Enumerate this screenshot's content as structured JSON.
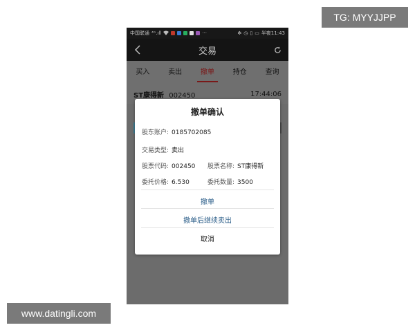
{
  "watermarks": {
    "tg": "TG: MYYJJPP",
    "site": "www.datingli.com"
  },
  "status_bar": {
    "carrier": "中国联通",
    "signal": "⁴ᴳ.ıll",
    "time": "半夜11:43",
    "battery": "▭"
  },
  "nav": {
    "title": "交易"
  },
  "tabs": [
    {
      "label": "买入"
    },
    {
      "label": "卖出"
    },
    {
      "label": "撤单"
    },
    {
      "label": "持仓"
    },
    {
      "label": "查询"
    }
  ],
  "order": {
    "name": "ST康得新",
    "code": "002450",
    "time": "17:44:06"
  },
  "dialog": {
    "title": "撤单确认",
    "account_label": "股东账户:",
    "account": "0185702085",
    "type_label": "交易类型:",
    "type": "卖出",
    "code_label": "股票代码:",
    "code": "002450",
    "name_label": "股票名称:",
    "name": "ST康得新",
    "price_label": "委托价格:",
    "price": "6.530",
    "qty_label": "委托数量:",
    "qty": "3500",
    "actions": {
      "cancel_order": "撤单",
      "cancel_and_sell": "撤单后继续卖出",
      "dismiss": "取消"
    }
  },
  "colors": {
    "accent_tab": "#7a1818",
    "link_blue": "#2d5f8a"
  }
}
